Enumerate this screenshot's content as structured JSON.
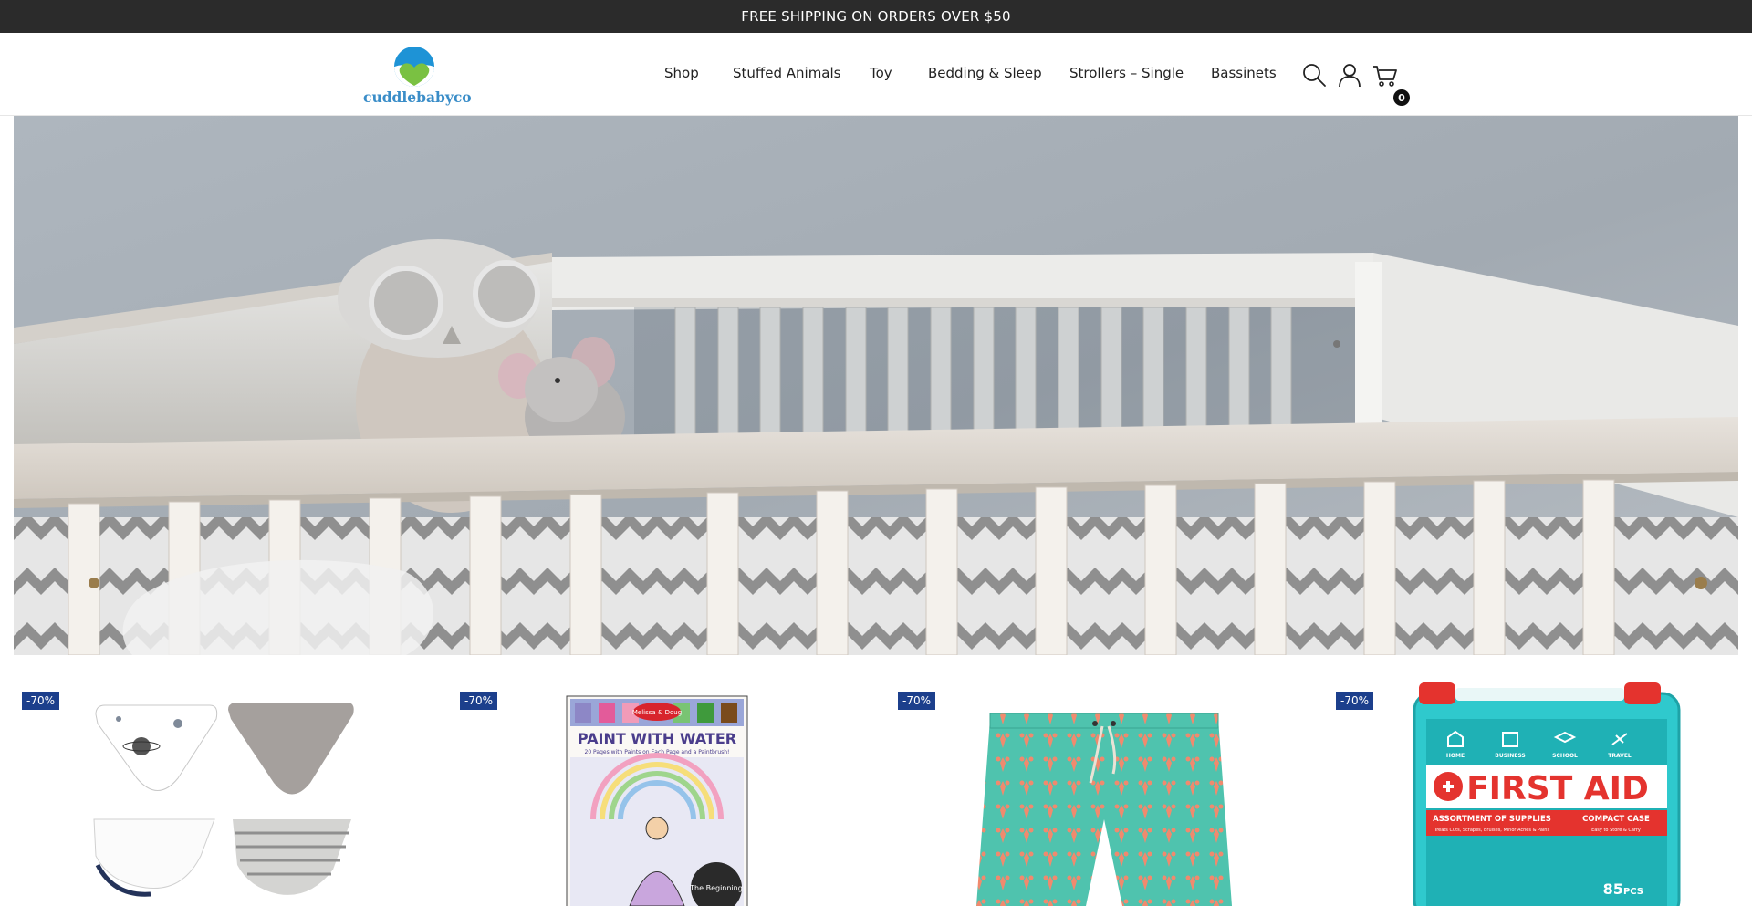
{
  "announcement": "FREE SHIPPING ON ORDERS OVER $50",
  "brand": {
    "name": "cuddlebabyco"
  },
  "nav": [
    {
      "label": "Shop"
    },
    {
      "label": "Stuffed Animals"
    },
    {
      "label": "Toy"
    },
    {
      "label": "Bedding & Sleep"
    },
    {
      "label": "Strollers – Single"
    },
    {
      "label": "Bassinets"
    }
  ],
  "header_icons": [
    "search-icon",
    "account-icon",
    "cart-icon"
  ],
  "cart": {
    "count": "0"
  },
  "hero": {
    "image": "nursery crib with owl pillow and plush mouse"
  },
  "products": [
    {
      "badge": "-70%",
      "image": "baby bandana bibs set"
    },
    {
      "badge": "-70%",
      "image": "Paint With Water activity book",
      "image_text": {
        "brand": "Melissa & Doug",
        "title": "PAINT WITH WATER",
        "subtitle": "20 Pages with Paints on Each Page and a Paintbrush!",
        "corner": "The Beginning"
      }
    },
    {
      "badge": "-70%",
      "image": "teal swim trunks with lobster print"
    },
    {
      "badge": "-70%",
      "image": "first aid kit",
      "image_text": {
        "categories": [
          "HOME",
          "BUSINESS",
          "SCHOOL",
          "TRAVEL"
        ],
        "title": "FIRST AID",
        "left_banner": "ASSORTMENT OF SUPPLIES",
        "right_banner": "COMPACT CASE",
        "left_sub": "Treats Cuts, Scrapes, Bruises, Minor Aches & Pains",
        "right_sub": "Easy to Store & Carry",
        "count": "85",
        "unit": "PCS"
      }
    }
  ],
  "colors": {
    "announcement_bg": "#2b2b2b",
    "badge_bg": "#1c3f8c",
    "logo_blue": "#3a8dc8",
    "logo_green": "#7ac142"
  }
}
